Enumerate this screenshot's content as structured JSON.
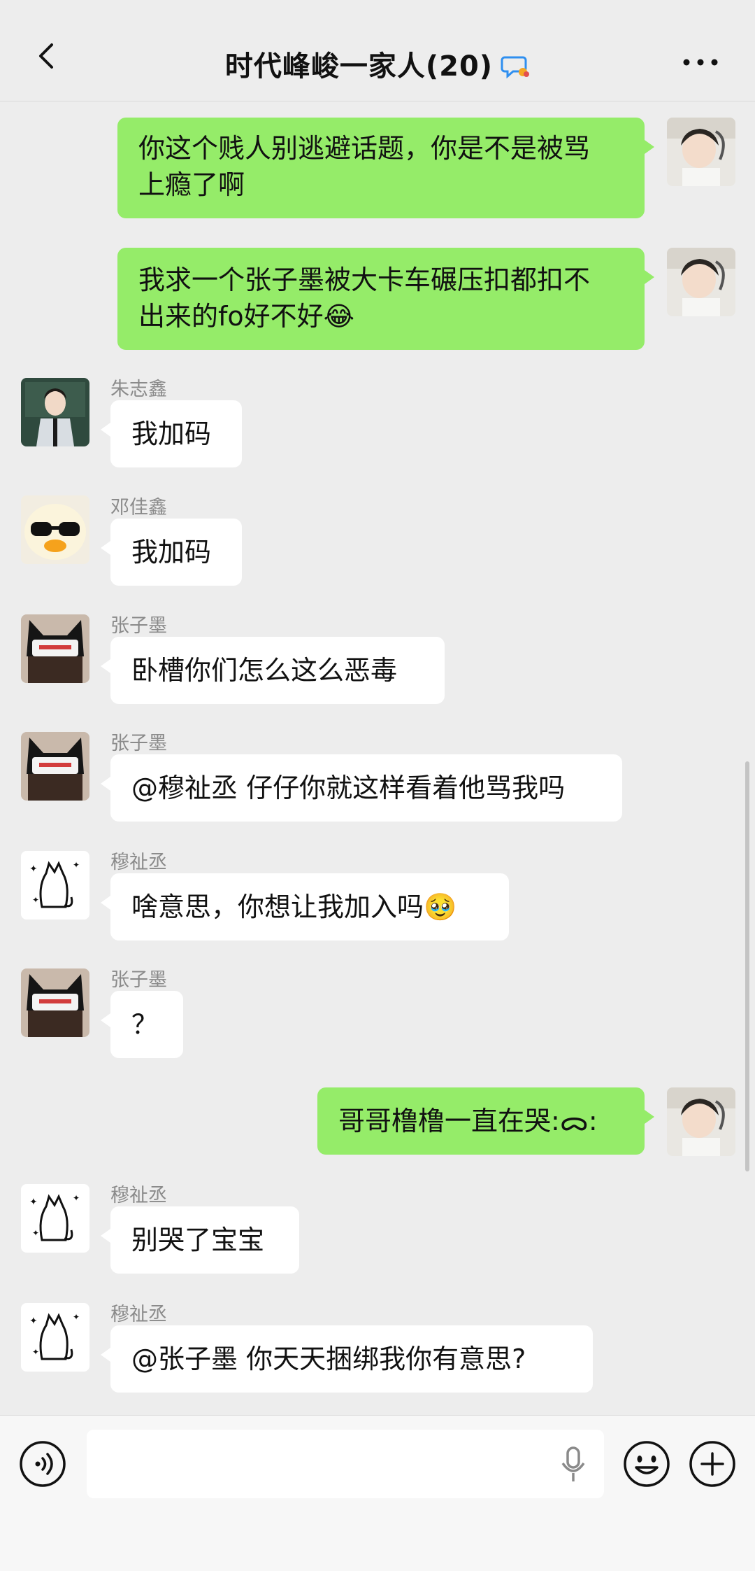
{
  "header": {
    "title": "时代峰峻一家人(20)"
  },
  "messages": [
    {
      "side": "out",
      "text_line1": "你这个贱人别逃避话题，你是不是被骂",
      "text_line2": "上瘾了啊",
      "avatar": "avatar-photo-boy"
    },
    {
      "side": "out",
      "text_line1": "我求一个张子墨被大卡车碾压扣都扣不",
      "text_line2": "出来的fo好不好😂",
      "avatar": "avatar-photo-boy"
    },
    {
      "side": "in",
      "name": "朱志鑫",
      "text": "我加码",
      "avatar": "avatar-suit-boy"
    },
    {
      "side": "in",
      "name": "邓佳鑫",
      "text": "我加码",
      "avatar": "avatar-duck-sunglasses"
    },
    {
      "side": "in",
      "name": "张子墨",
      "text": "卧槽你们怎么这么恶毒",
      "avatar": "avatar-cat-ear-hat"
    },
    {
      "side": "in",
      "name": "张子墨",
      "text": "@穆祉丞 仔仔你就这样看着他骂我吗",
      "avatar": "avatar-cat-ear-hat"
    },
    {
      "side": "in",
      "name": "穆祉丞",
      "text": "啥意思，你想让我加入吗🥹",
      "avatar": "avatar-doodle-cat"
    },
    {
      "side": "in",
      "name": "张子墨",
      "text": "？",
      "avatar": "avatar-cat-ear-hat"
    },
    {
      "side": "out",
      "text": "哥哥橹橹一直在哭:ᯅ:",
      "avatar": "avatar-photo-boy"
    },
    {
      "side": "in",
      "name": "穆祉丞",
      "text": "别哭了宝宝",
      "avatar": "avatar-doodle-cat"
    },
    {
      "side": "in",
      "name": "穆祉丞",
      "text": "@张子墨 你天天捆绑我你有意思?",
      "avatar": "avatar-doodle-cat"
    }
  ],
  "colors": {
    "background": "#ededed",
    "outgoing_bubble": "#95ec69",
    "incoming_bubble": "#ffffff",
    "name_text": "#8a8a8a"
  },
  "input": {
    "value": ""
  }
}
